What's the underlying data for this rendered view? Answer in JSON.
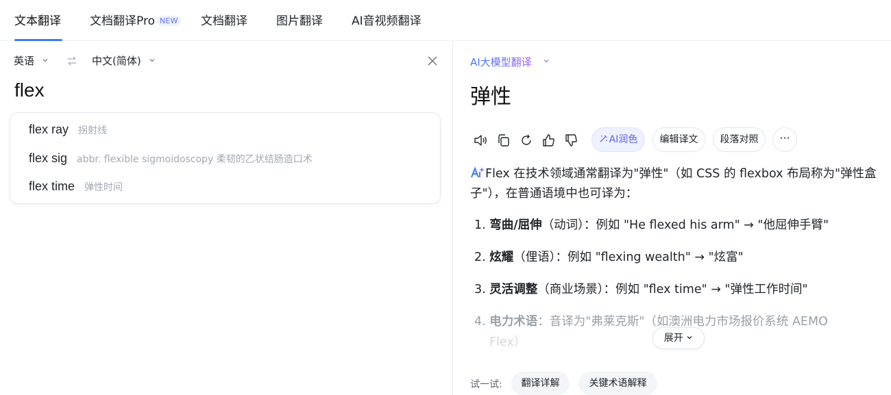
{
  "tabs": [
    {
      "label": "文本翻译"
    },
    {
      "label": "文档翻译Pro",
      "badge": "NEW"
    },
    {
      "label": "文档翻译"
    },
    {
      "label": "图片翻译"
    },
    {
      "label": "AI音视频翻译"
    }
  ],
  "source": {
    "lang": "英语",
    "target_lang": "中文(简体)",
    "text": "flex",
    "suggestions": [
      {
        "word": "flex ray",
        "def": "拐射线"
      },
      {
        "word": "flex sig",
        "def": "abbr. flexible sigmoidoscopy 柔韧的乙状结肠造口术"
      },
      {
        "word": "flex time",
        "def": "弹性时间"
      }
    ]
  },
  "target": {
    "model": "AI大模型翻译",
    "text": "弹性",
    "toolbar": {
      "ai_polish": "AI润色",
      "edit": "编辑译文",
      "compare": "段落对照",
      "more": "···"
    },
    "answer_intro": "Flex 在技术领域通常翻译为\"弹性\"（如 CSS 的 flexbox 布局称为\"弹性盒子\"），在普通语境中也可译为：",
    "items": [
      {
        "num": "1.",
        "term": "弯曲/屈伸",
        "rest": "（动词）：例如 \"He flexed his arm\" → \"他屈伸手臂\""
      },
      {
        "num": "2.",
        "term": "炫耀",
        "rest": "（俚语）：例如 \"flexing wealth\" → \"炫富\""
      },
      {
        "num": "3.",
        "term": "灵活调整",
        "rest": "（商业场景）：例如 \"flex time\" → \"弹性工作时间\""
      },
      {
        "num": "4.",
        "term": "电力术语",
        "rest": "：音译为\"弗莱克斯\"（如澳洲电力市场报价系统 AEMO",
        "cont": "Flex）"
      }
    ],
    "expand": "展开",
    "try_label": "试一试:",
    "try_items": [
      "翻译详解",
      "关键术语解释"
    ]
  },
  "colors": {
    "accent": "#3a7bf8",
    "ai_gradient_end": "#a05ef0"
  }
}
